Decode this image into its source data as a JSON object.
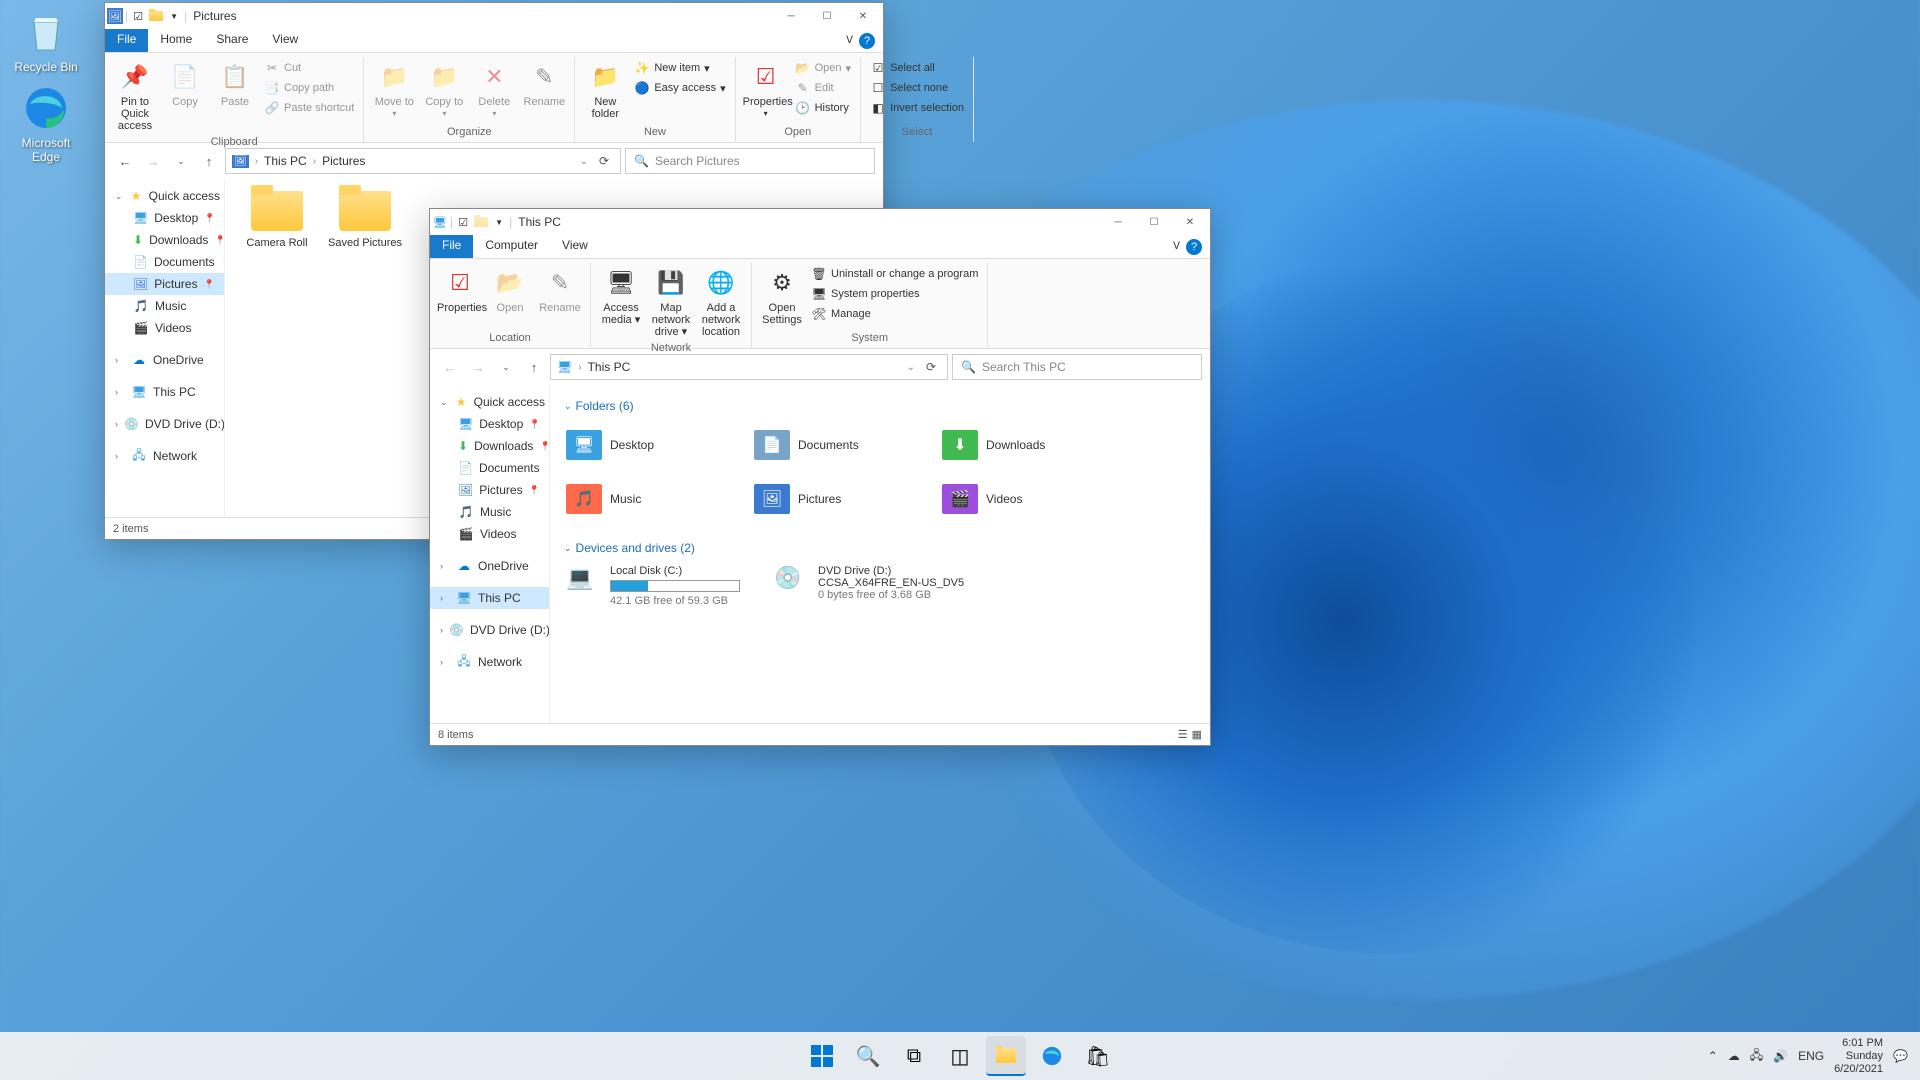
{
  "desktop": {
    "recycle_bin": "Recycle Bin",
    "edge": "Microsoft Edge"
  },
  "win1": {
    "title": "Pictures",
    "tabs": {
      "file": "File",
      "home": "Home",
      "share": "Share",
      "view": "View"
    },
    "ribbon": {
      "clipboard": {
        "label": "Clipboard",
        "pin": "Pin to Quick access",
        "copy": "Copy",
        "paste": "Paste",
        "cut": "Cut",
        "copy_path": "Copy path",
        "paste_shortcut": "Paste shortcut"
      },
      "organize": {
        "label": "Organize",
        "move_to": "Move to",
        "copy_to": "Copy to",
        "delete": "Delete",
        "rename": "Rename"
      },
      "new": {
        "label": "New",
        "new_folder": "New folder",
        "new_item": "New item",
        "easy_access": "Easy access"
      },
      "open": {
        "label": "Open",
        "properties": "Properties",
        "open": "Open",
        "edit": "Edit",
        "history": "History"
      },
      "select": {
        "label": "Select",
        "select_all": "Select all",
        "select_none": "Select none",
        "invert": "Invert selection"
      }
    },
    "breadcrumbs": [
      "This PC",
      "Pictures"
    ],
    "search_placeholder": "Search Pictures",
    "nav": {
      "quick_access": "Quick access",
      "desktop": "Desktop",
      "downloads": "Downloads",
      "documents": "Documents",
      "pictures": "Pictures",
      "music": "Music",
      "videos": "Videos",
      "onedrive": "OneDrive",
      "this_pc": "This PC",
      "dvd": "DVD Drive (D:) CCSA",
      "network": "Network"
    },
    "items": [
      "Camera Roll",
      "Saved Pictures"
    ],
    "status": "2 items"
  },
  "win2": {
    "title": "This PC",
    "tabs": {
      "file": "File",
      "computer": "Computer",
      "view": "View"
    },
    "ribbon": {
      "location": {
        "label": "Location",
        "properties": "Properties",
        "open": "Open",
        "rename": "Rename"
      },
      "network": {
        "label": "Network",
        "access_media": "Access media",
        "map_drive": "Map network drive",
        "add_loc": "Add a network location"
      },
      "system": {
        "label": "System",
        "open_settings": "Open Settings",
        "uninstall": "Uninstall or change a program",
        "sys_props": "System properties",
        "manage": "Manage"
      }
    },
    "breadcrumbs": [
      "This PC"
    ],
    "search_placeholder": "Search This PC",
    "nav": {
      "quick_access": "Quick access",
      "desktop": "Desktop",
      "downloads": "Downloads",
      "documents": "Documents",
      "pictures": "Pictures",
      "music": "Music",
      "videos": "Videos",
      "onedrive": "OneDrive",
      "this_pc": "This PC",
      "dvd": "DVD Drive (D:) CCSA",
      "network": "Network"
    },
    "folders_header": "Folders (6)",
    "folders": [
      {
        "name": "Desktop",
        "color": "#3aa0e0"
      },
      {
        "name": "Documents",
        "color": "#7aa3c8"
      },
      {
        "name": "Downloads",
        "color": "#3fb950"
      },
      {
        "name": "Music",
        "color": "#ff6b4a"
      },
      {
        "name": "Pictures",
        "color": "#3a7ad0"
      },
      {
        "name": "Videos",
        "color": "#9d4edd"
      }
    ],
    "drives_header": "Devices and drives (2)",
    "drives": [
      {
        "name": "Local Disk (C:)",
        "free": "42.1 GB free of 59.3 GB",
        "fill_pct": 29
      },
      {
        "name": "DVD Drive (D:)",
        "sub": "CCSA_X64FRE_EN-US_DV5",
        "free": "0 bytes free of 3.68 GB"
      }
    ],
    "status": "8 items"
  },
  "taskbar": {
    "lang": "ENG",
    "time": "6:01 PM",
    "day": "Sunday",
    "date": "6/20/2021"
  }
}
